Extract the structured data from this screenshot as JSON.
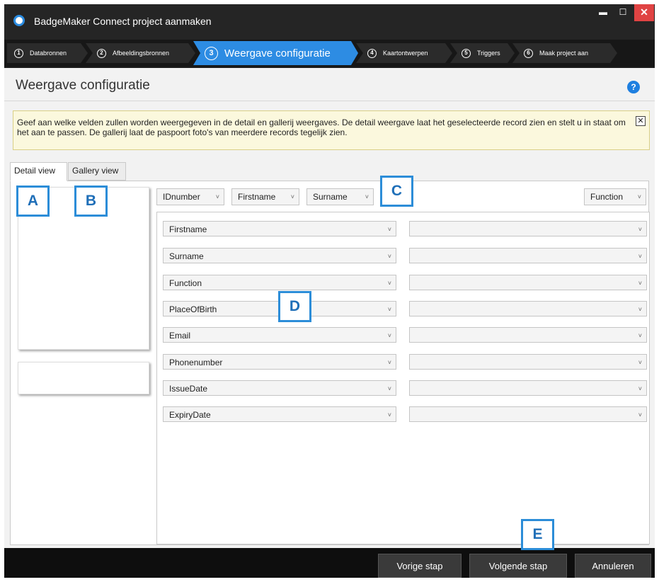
{
  "window": {
    "title": "BadgeMaker Connect project aanmaken",
    "minimize": "▬",
    "maximize": "☐",
    "close": "✕"
  },
  "steps": [
    {
      "num": "1",
      "label": "Databronnen"
    },
    {
      "num": "2",
      "label": "Afbeeldingsbronnen"
    },
    {
      "num": "3",
      "label": "Weergave configuratie"
    },
    {
      "num": "4",
      "label": "Kaartontwerpen"
    },
    {
      "num": "5",
      "label": "Triggers"
    },
    {
      "num": "6",
      "label": "Maak project aan"
    }
  ],
  "page": {
    "title": "Weergave configuratie",
    "help": "?"
  },
  "info": {
    "text": "Geef aan welke velden zullen worden weergegeven in de detail en gallerij weergaves. De detail weergave laat het geselecteerde record zien en stelt u in staat om het aan te passen. De gallerij laat de paspoort foto's van meerdere records tegelijk zien.",
    "close": "✕"
  },
  "tabs": {
    "detail": "Detail view",
    "gallery": "Gallery view"
  },
  "header_fields": {
    "f1": "IDnumber",
    "f2": "Firstname",
    "f3": "Surname",
    "right": "Function"
  },
  "field_rows": [
    {
      "left": "Firstname",
      "right": ""
    },
    {
      "left": "Surname",
      "right": ""
    },
    {
      "left": "Function",
      "right": ""
    },
    {
      "left": "PlaceOfBirth",
      "right": ""
    },
    {
      "left": "Email",
      "right": ""
    },
    {
      "left": "Phonenumber",
      "right": ""
    },
    {
      "left": "IssueDate",
      "right": ""
    },
    {
      "left": "ExpiryDate",
      "right": ""
    }
  ],
  "callouts": {
    "a": "A",
    "b": "B",
    "c": "C",
    "d": "D",
    "e": "E"
  },
  "buttons": {
    "prev": "Vorige stap",
    "next": "Volgende stap",
    "cancel": "Annuleren"
  },
  "dropdown_arrow": "˅",
  "colors": {
    "accent": "#2d8ce3",
    "close": "#e04343",
    "callout_border": "#2c8dd8",
    "info_bg": "#fbf8dd"
  }
}
